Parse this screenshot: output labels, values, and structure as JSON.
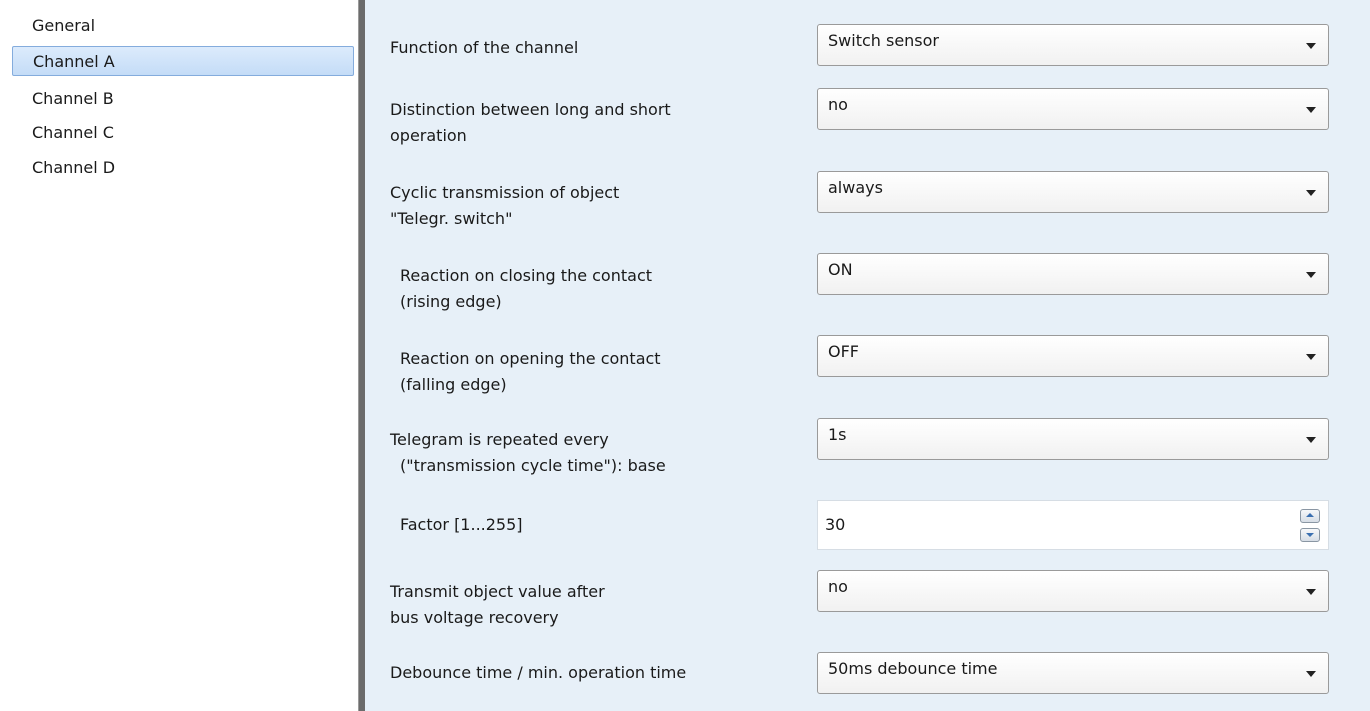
{
  "sidebar": {
    "items": [
      {
        "label": "General"
      },
      {
        "label": "Channel A"
      },
      {
        "label": "Channel B"
      },
      {
        "label": "Channel C"
      },
      {
        "label": "Channel D"
      }
    ],
    "selected": "Channel A"
  },
  "params": {
    "function": {
      "line1": "Function of the channel",
      "value": "Switch sensor"
    },
    "distinction": {
      "line1": "Distinction between long and short",
      "line2": "operation",
      "value": "no"
    },
    "cyclic": {
      "line1": "Cyclic transmission of object",
      "line2": "\"Telegr. switch\"",
      "value": "always"
    },
    "closing": {
      "line1": "Reaction on closing the contact",
      "line2": "(rising edge)",
      "value": "ON"
    },
    "opening": {
      "line1": "Reaction on opening the contact",
      "line2": "(falling edge)",
      "value": "OFF"
    },
    "repeat": {
      "line1": "Telegram is repeated every",
      "line2": "(\"transmission cycle time\"): base",
      "value": "1s"
    },
    "factor": {
      "line1": "Factor [1...255]",
      "value": "30"
    },
    "transmit": {
      "line1": "Transmit object value after",
      "line2": "bus voltage recovery",
      "value": "no"
    },
    "debounce": {
      "line1": "Debounce time / min. operation time",
      "value": "50ms debounce time"
    }
  },
  "colors": {
    "main_bg": "#e7f0f8",
    "selection": "#c4dcf7",
    "splitter": "#6b6b6b"
  }
}
